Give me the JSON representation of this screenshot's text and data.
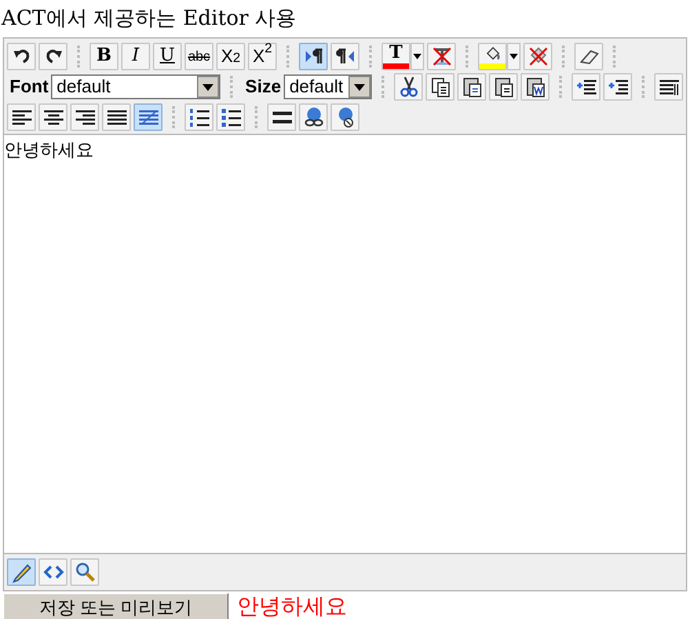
{
  "title": "ACT에서 제공하는 Editor 사용",
  "toolbar_rows": [
    [
      {
        "kind": "undo"
      },
      {
        "kind": "redo"
      },
      {
        "kind": "sep"
      },
      {
        "kind": "bold",
        "label": "B"
      },
      {
        "kind": "italic",
        "label": "I"
      },
      {
        "kind": "underline",
        "label": "U"
      },
      {
        "kind": "strike",
        "label": "abc"
      },
      {
        "kind": "subscript",
        "label": "X$_{2}$"
      },
      {
        "kind": "superscript",
        "label": "X$^{2}$"
      },
      {
        "kind": "sep"
      },
      {
        "kind": "ltr",
        "selected": true
      },
      {
        "kind": "rtl",
        "selected": false
      },
      {
        "kind": "sep"
      },
      {
        "kind": "textcolor",
        "label": "T",
        "color": "#ff0000"
      },
      {
        "kind": "removetext"
      },
      {
        "kind": "sep"
      },
      {
        "kind": "bgcolor",
        "color": "#ffff00"
      },
      {
        "kind": "removebg"
      },
      {
        "kind": "sep"
      },
      {
        "kind": "eraser"
      },
      {
        "kind": "sep"
      }
    ],
    [
      {
        "kind": "select",
        "label": "Font",
        "value": "default",
        "wide": true
      },
      {
        "kind": "sep"
      },
      {
        "kind": "select",
        "label": "Size",
        "value": "default",
        "wide": false
      },
      {
        "kind": "sep"
      },
      {
        "kind": "cut"
      },
      {
        "kind": "copy"
      },
      {
        "kind": "paste"
      },
      {
        "kind": "pastetext"
      },
      {
        "kind": "pasteword"
      },
      {
        "kind": "sep"
      },
      {
        "kind": "outdent"
      },
      {
        "kind": "indent"
      },
      {
        "kind": "sep"
      },
      {
        "kind": "paragraph"
      }
    ],
    [
      {
        "kind": "alignleft",
        "selected": false
      },
      {
        "kind": "aligncenter",
        "selected": false
      },
      {
        "kind": "alignright",
        "selected": false
      },
      {
        "kind": "alignjustify",
        "selected": false
      },
      {
        "kind": "alignfull",
        "selected": true
      },
      {
        "kind": "sep"
      },
      {
        "kind": "ol"
      },
      {
        "kind": "ul"
      },
      {
        "kind": "sep"
      },
      {
        "kind": "hr"
      },
      {
        "kind": "link"
      },
      {
        "kind": "unlink"
      }
    ]
  ],
  "content": "안녕하세요",
  "mode_buttons": [
    {
      "kind": "design",
      "selected": true
    },
    {
      "kind": "html",
      "selected": false
    },
    {
      "kind": "preview",
      "selected": false
    }
  ],
  "submit_button": "저장 또는 미리보기",
  "output": "안녕하세요"
}
